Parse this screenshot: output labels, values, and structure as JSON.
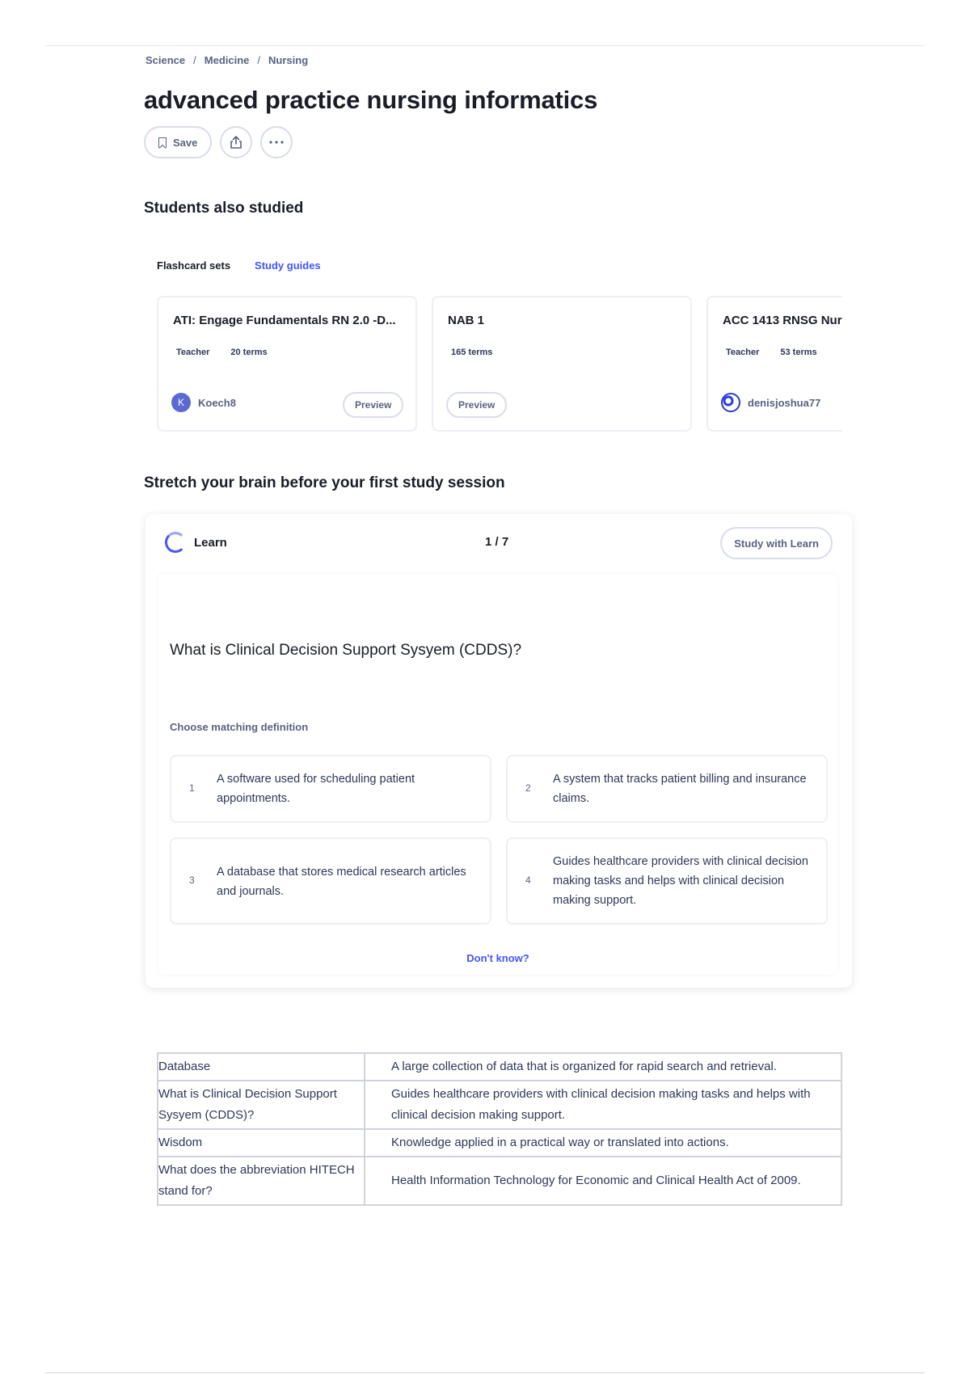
{
  "breadcrumb": [
    "Science",
    "Medicine",
    "Nursing"
  ],
  "title": "advanced practice nursing informatics",
  "actions": {
    "save_label": "Save"
  },
  "students_also_studied": {
    "heading": "Students also studied",
    "tabs": [
      "Flashcard sets",
      "Study guides"
    ],
    "cards": [
      {
        "title": "ATI: Engage Fundamentals RN 2.0 -D...",
        "badge": "Teacher",
        "terms": "20 terms",
        "user": "Koech8",
        "avatar_letter": "K",
        "preview": "Preview"
      },
      {
        "title": "NAB 1",
        "badge": "",
        "terms": "165 terms",
        "user": "",
        "avatar_letter": "",
        "preview": "Preview"
      },
      {
        "title": "ACC 1413 RNSG Nur",
        "badge": "Teacher",
        "terms": "53 terms",
        "user": "denisjoshua77",
        "avatar_letter": "",
        "preview": ""
      }
    ]
  },
  "learn": {
    "heading": "Stretch your brain before your first study session",
    "mode_label": "Learn",
    "progress": "1 / 7",
    "study_button": "Study with Learn",
    "question": "What is Clinical Decision Support Sysyem (CDDS)?",
    "prompt": "Choose matching definition",
    "options": [
      {
        "num": "1",
        "text": "A software used for scheduling patient appointments."
      },
      {
        "num": "2",
        "text": "A system that tracks patient billing and insurance claims."
      },
      {
        "num": "3",
        "text": "A database that stores medical research articles and journals."
      },
      {
        "num": "4",
        "text": "Guides healthcare providers with clinical decision making tasks and helps with clinical decision making support."
      }
    ],
    "dont_know": "Don't know?"
  },
  "terms_table": [
    {
      "term": "Database",
      "definition": "A large collection of data that is organized for rapid search and retrieval."
    },
    {
      "term": "What is Clinical Decision Support Sysyem (CDDS)?",
      "definition": "Guides healthcare providers with clinical decision making tasks and helps with clinical decision making support."
    },
    {
      "term": "Wisdom",
      "definition": "Knowledge applied in a practical way or translated into actions."
    },
    {
      "term": "What does the abbreviation HITECH stand for?",
      "definition": "Health Information Technology for Economic and Clinical Health Act of 2009."
    }
  ],
  "colors": {
    "accent": "#4255ff",
    "text": "#1a1d28",
    "muted": "#586380",
    "border": "#d9dde8"
  }
}
